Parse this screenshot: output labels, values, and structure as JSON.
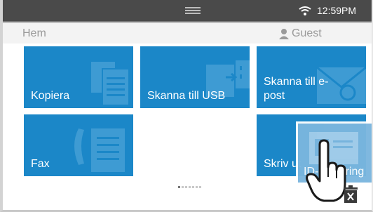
{
  "status": {
    "time": "12:59PM",
    "wifi_icon": "wifi-icon",
    "handle_icon": "drag-handle-icon"
  },
  "header": {
    "home_label": "Hem",
    "user_label": "Guest",
    "user_icon": "user-icon"
  },
  "tiles": [
    {
      "label": "Kopiera",
      "icon": "copy-icon"
    },
    {
      "label": "Skanna till USB",
      "icon": "usb-icon"
    },
    {
      "label": "Skanna till e-post",
      "icon": "email-icon"
    },
    {
      "label": "Fax",
      "icon": "fax-icon"
    },
    {
      "label": "Skriv ut",
      "icon": "print-icon"
    }
  ],
  "dragging_tile": {
    "label": "ID-kopiering",
    "icon": "id-card-icon"
  },
  "pager": {
    "pages": 7,
    "current": 1
  },
  "drag_icons": {
    "hand": "hand-pointer-icon",
    "trash": "trash-icon"
  },
  "colors": {
    "tile": "#1b87c8",
    "statusbar": "#4a4a4a",
    "header_bg": "#f3f3f3",
    "header_text": "#9a9a9a"
  }
}
